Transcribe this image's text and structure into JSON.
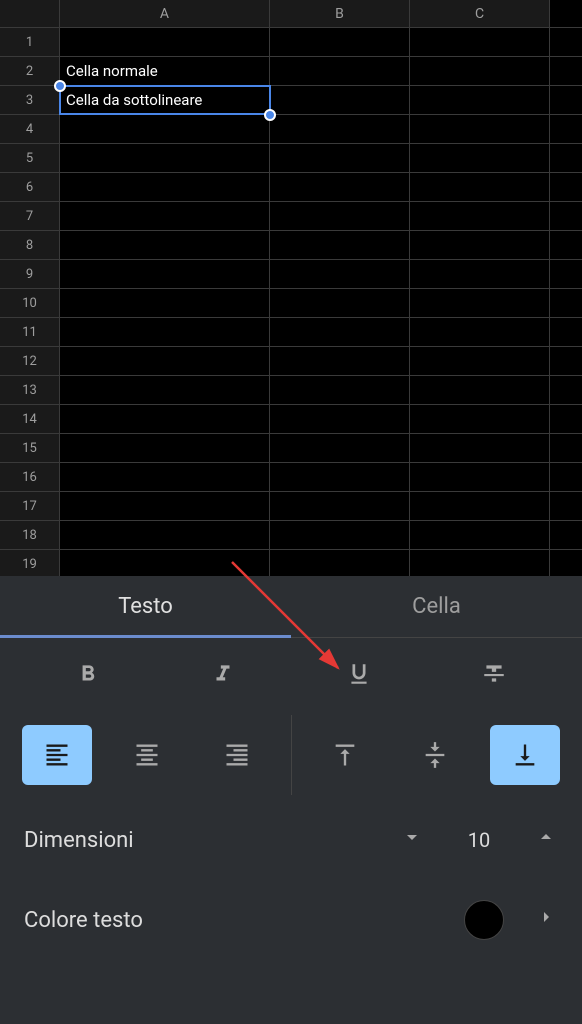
{
  "columns": [
    "A",
    "B",
    "C"
  ],
  "rows": [
    1,
    2,
    3,
    4,
    5,
    6,
    7,
    8,
    9,
    10,
    11,
    12,
    13,
    14,
    15,
    16,
    17,
    18,
    19
  ],
  "cells": {
    "A2": "Cella normale",
    "A3": "Cella da sottolineare"
  },
  "selected_cell": "A3",
  "panel": {
    "tabs": {
      "text": "Testo",
      "cell": "Cella"
    },
    "active_tab": "text",
    "size": {
      "label": "Dimensioni",
      "value": "10"
    },
    "text_color": {
      "label": "Colore testo",
      "value": "#000000"
    }
  }
}
